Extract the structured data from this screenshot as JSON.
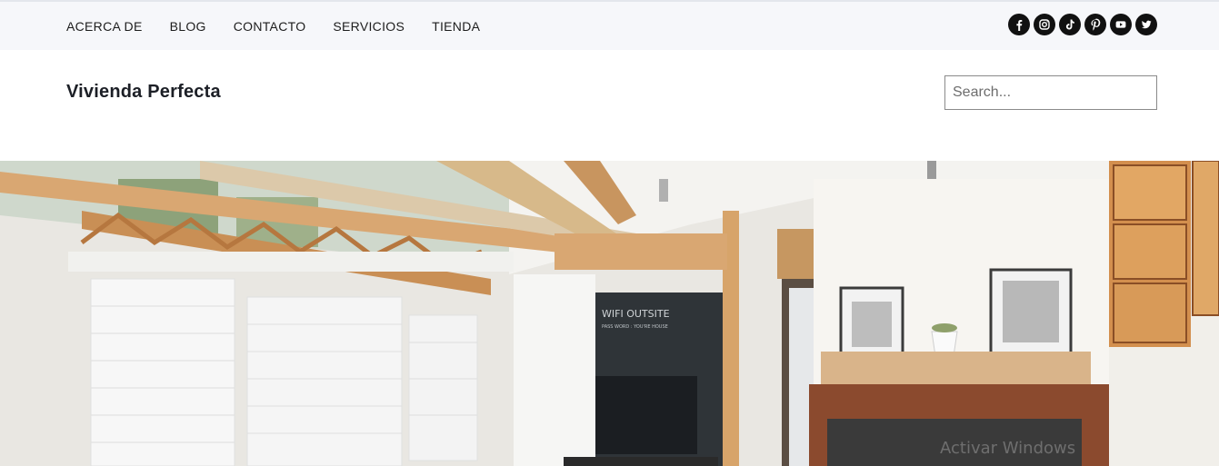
{
  "top_nav": {
    "items": [
      {
        "label": "ACERCA DE"
      },
      {
        "label": "BLOG"
      },
      {
        "label": "CONTACTO"
      },
      {
        "label": "SERVICIOS"
      },
      {
        "label": "TIENDA"
      }
    ]
  },
  "social": [
    {
      "icon": "facebook-icon"
    },
    {
      "icon": "instagram-icon"
    },
    {
      "icon": "tiktok-icon"
    },
    {
      "icon": "pinterest-icon"
    },
    {
      "icon": "youtube-icon"
    },
    {
      "icon": "twitter-icon"
    }
  ],
  "header": {
    "site_title": "Vivienda Perfecta",
    "search_placeholder": "Search..."
  },
  "hero": {
    "board_line1": "WIFI OUTSITE",
    "board_line2": "PASS WORD : YOU'RE HOUSE"
  },
  "os_overlay": {
    "watermark": "Activar Windows"
  },
  "colors": {
    "topbar_bg": "#f6f7fa",
    "icon_bg": "#111111",
    "wood": "#d9a772"
  }
}
